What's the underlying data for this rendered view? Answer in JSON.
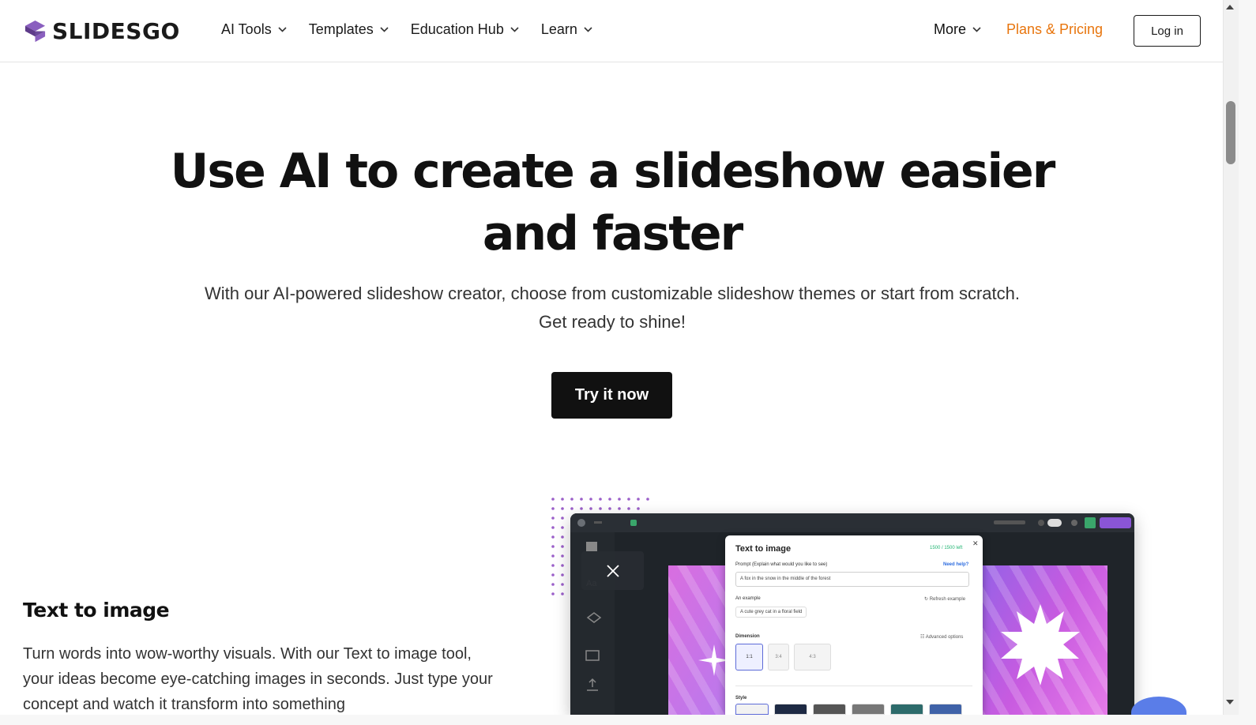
{
  "header": {
    "logo_text": "SLIDESGO",
    "nav": [
      {
        "label": "AI Tools"
      },
      {
        "label": "Templates"
      },
      {
        "label": "Education Hub"
      },
      {
        "label": "Learn"
      }
    ],
    "more_label": "More",
    "pricing_label": "Plans & Pricing",
    "login_label": "Log in"
  },
  "hero": {
    "title": "Use AI to create a slideshow easier and faster",
    "subtitle": "With our AI-powered slideshow creator, choose from customizable slideshow themes or start from scratch. Get ready to shine!",
    "cta_label": "Try it now"
  },
  "feature": {
    "title": "Text to image",
    "body": "Turn words into wow-worthy visuals. With our Text to image tool, your ideas become eye-catching images in seconds. Just type your concept and watch it transform into something"
  },
  "mockup_panel": {
    "title": "Text to image",
    "count": "1500 / 1500 left",
    "prompt_label": "Prompt (Explain what would you like to see)",
    "need_help": "Need help?",
    "prompt_value": "A fox in the snow in the middle of the forest",
    "example_label": "An example",
    "refresh_label": "Refresh example",
    "example_chip": "A cute grey cat in a floral field",
    "dimension_label": "Dimension",
    "advanced_label": "Advanced options",
    "dimensions": [
      "1:1",
      "3:4",
      "4:3"
    ],
    "style_label": "Style"
  },
  "colors": {
    "accent_orange": "#e8750d",
    "brand_purple": "#7b4fa8",
    "cta_bg": "#111111"
  }
}
